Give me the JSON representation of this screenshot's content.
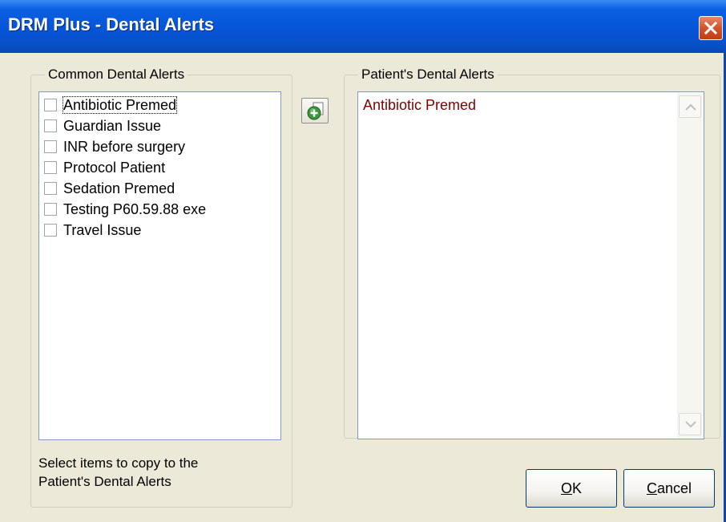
{
  "window": {
    "title": "DRM Plus - Dental Alerts",
    "close_icon": "close-icon"
  },
  "common_alerts": {
    "legend": "Common Dental Alerts",
    "items": [
      {
        "label": "Antibiotic Premed",
        "checked": false,
        "focused": true
      },
      {
        "label": "Guardian Issue",
        "checked": false
      },
      {
        "label": "INR before surgery",
        "checked": false
      },
      {
        "label": "Protocol Patient",
        "checked": false
      },
      {
        "label": "Sedation Premed",
        "checked": false
      },
      {
        "label": "Testing P60.59.88 exe",
        "checked": false
      },
      {
        "label": "Travel Issue",
        "checked": false
      }
    ],
    "hint_line1": "Select items to copy to the",
    "hint_line2": "Patient's Dental Alerts"
  },
  "add_button": {
    "icon": "add-icon"
  },
  "patient_alerts": {
    "legend": "Patient's Dental Alerts",
    "items": [
      {
        "label": "Antibiotic Premed"
      }
    ],
    "text_color": "#800000"
  },
  "buttons": {
    "ok_mnemonic": "O",
    "ok_rest": "K",
    "cancel_mnemonic": "C",
    "cancel_rest": "ancel"
  },
  "colors": {
    "titlebar": "#0655d8",
    "dialog_bg": "#ece9d8",
    "close_button": "#d4532a"
  }
}
